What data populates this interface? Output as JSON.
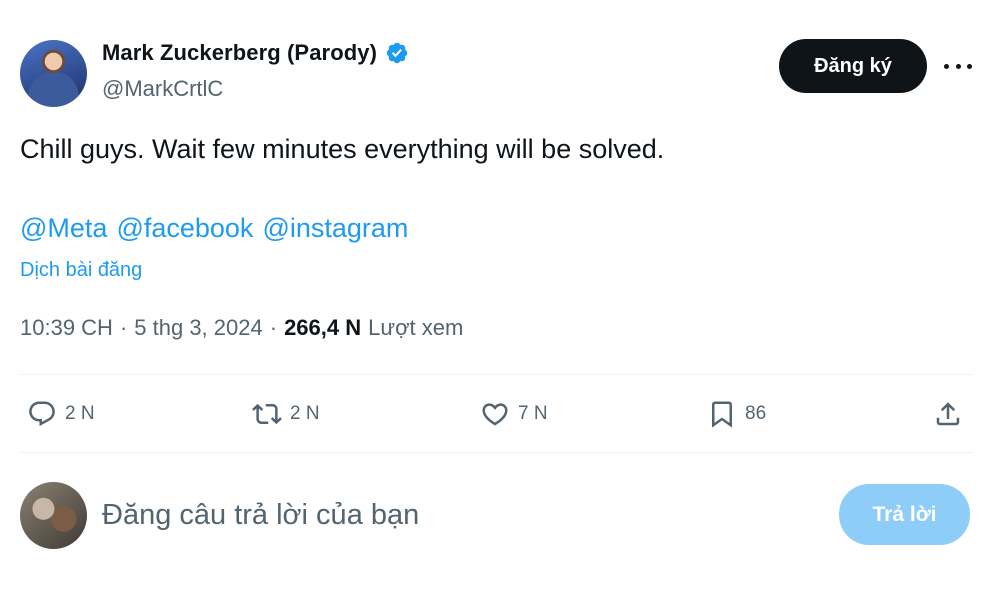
{
  "author": {
    "display_name": "Mark Zuckerberg (Parody)",
    "handle": "@MarkCrtlC",
    "verified_icon": "verified-badge-icon",
    "avatar_icon": "profile-photo"
  },
  "header": {
    "subscribe_label": "Đăng ký",
    "more_icon": "more-horizontal-icon"
  },
  "post": {
    "text": "Chill guys. Wait few minutes everything will be solved.",
    "mentions": [
      "@Meta",
      "@facebook",
      "@instagram"
    ],
    "translate_label": "Dịch bài đăng"
  },
  "meta": {
    "time": "10:39 CH",
    "separator": "·",
    "date": "5 thg 3, 2024",
    "views_count": "266,4 N",
    "views_label": "Lượt xem"
  },
  "actions": {
    "reply": {
      "icon": "reply-icon",
      "count": "2 N"
    },
    "repost": {
      "icon": "repost-icon",
      "count": "2 N"
    },
    "like": {
      "icon": "heart-icon",
      "count": "7 N"
    },
    "bookmark": {
      "icon": "bookmark-icon",
      "count": "86"
    },
    "share": {
      "icon": "share-icon"
    }
  },
  "composer": {
    "placeholder": "Đăng câu trả lời của bạn",
    "reply_button_label": "Trả lời"
  },
  "colors": {
    "accent": "#1d9bf0",
    "text_primary": "#0f1419",
    "text_secondary": "#536471",
    "button_dark": "#0f1419",
    "button_disabled": "#8ecdf8"
  }
}
